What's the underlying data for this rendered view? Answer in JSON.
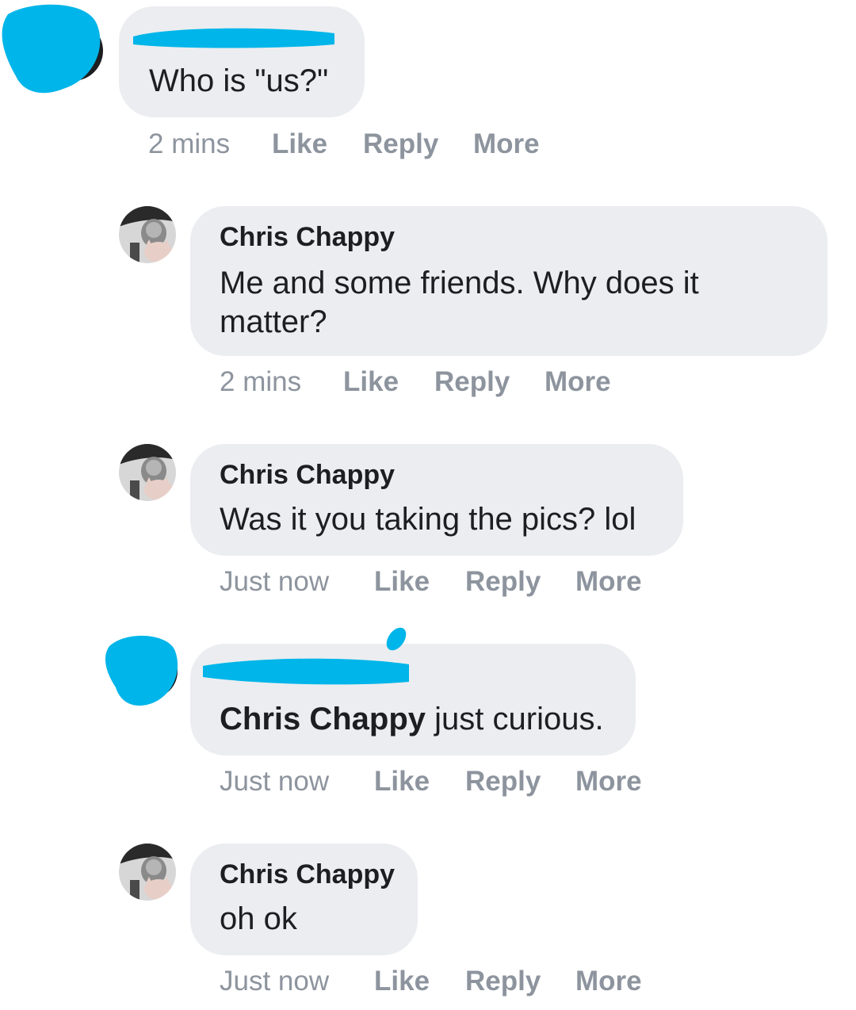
{
  "comments": [
    {
      "id": "c1",
      "author": "",
      "author_redacted": true,
      "text": "Who is \"us?\"",
      "time": "2 mins",
      "actions": [
        "Like",
        "Reply",
        "More"
      ]
    },
    {
      "id": "c2",
      "author": "Chris Chappy",
      "text": "Me and some friends. Why does it matter?",
      "time": "2 mins",
      "actions": [
        "Like",
        "Reply",
        "More"
      ]
    },
    {
      "id": "c3",
      "author": "Chris Chappy",
      "text": "Was it you taking the pics? lol",
      "time": "Just now",
      "actions": [
        "Like",
        "Reply",
        "More"
      ]
    },
    {
      "id": "c4",
      "author": "",
      "author_redacted": true,
      "mention": "Chris Chappy",
      "text": "just curious.",
      "time": "Just now",
      "actions": [
        "Like",
        "Reply",
        "More"
      ]
    },
    {
      "id": "c5",
      "author": "Chris Chappy",
      "text": "oh ok",
      "time": "Just now",
      "actions": [
        "Like",
        "Reply",
        "More"
      ]
    }
  ],
  "colors": {
    "bubble": "#ebedf0",
    "meta": "#8d949e",
    "text": "#1c1e21",
    "redaction": "#00b5e9"
  }
}
